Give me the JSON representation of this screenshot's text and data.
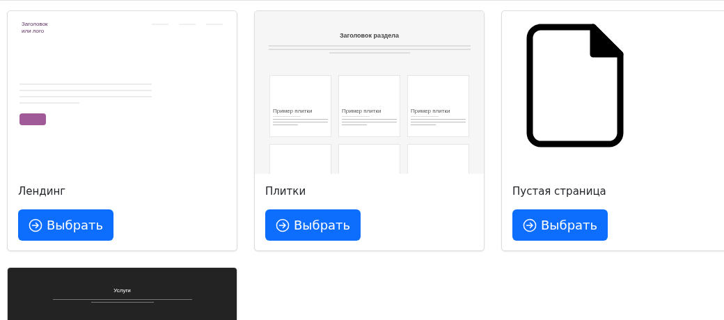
{
  "templates": [
    {
      "kind": "landing",
      "name": "Лендинг",
      "preview": {
        "logo": "Заголовок\nили лого"
      },
      "button": "Выбрать"
    },
    {
      "kind": "tiles",
      "name": "Плитки",
      "preview": {
        "heading": "Заголовок раздела",
        "tiles": [
          {
            "kind": "sample",
            "title": "Пример плитки"
          },
          {
            "kind": "sample",
            "title": "Пример плитки"
          },
          {
            "kind": "sample",
            "title": "Пример плитки"
          },
          {
            "kind": "empty"
          },
          {
            "kind": "empty"
          },
          {
            "kind": "empty"
          }
        ]
      },
      "button": "Выбрать"
    },
    {
      "kind": "blank",
      "name": "Пустая страница",
      "button": "Выбрать"
    },
    {
      "kind": "services",
      "preview": {
        "heading": "Услуги"
      }
    }
  ]
}
